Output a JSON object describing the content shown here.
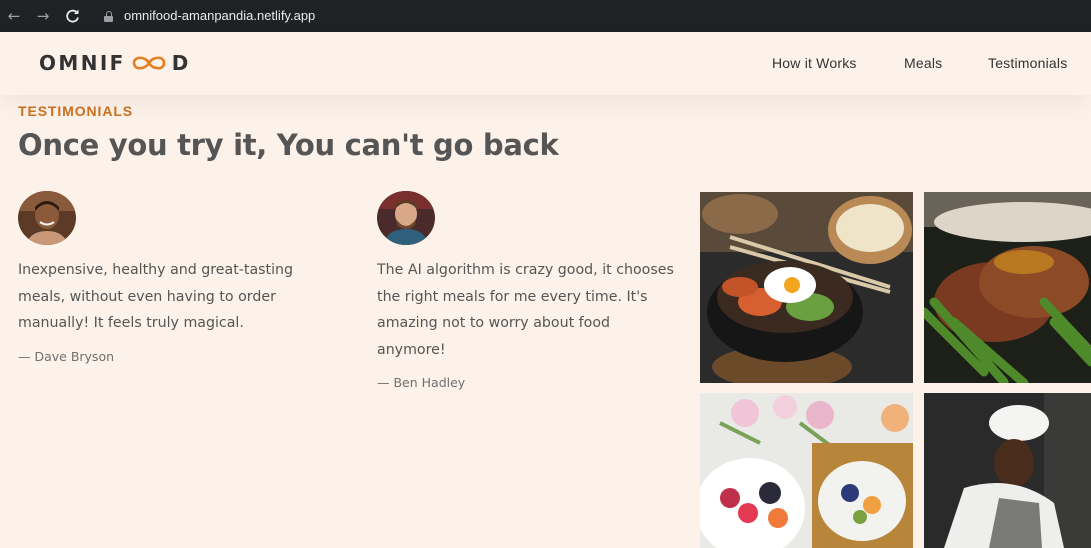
{
  "browser": {
    "url": "omnifood-amanpandia.netlify.app",
    "back_icon": "←",
    "forward_icon": "→",
    "reload_icon": "C"
  },
  "header": {
    "logo_left": "OMNIF",
    "logo_right": "D",
    "nav": [
      {
        "label": "How it Works"
      },
      {
        "label": "Meals"
      },
      {
        "label": "Testimonials"
      }
    ]
  },
  "section": {
    "eyebrow": "TESTIMONIALS",
    "heading": "Once you try it, You can't go back"
  },
  "testimonials": [
    {
      "quote": "Inexpensive, healthy and great-tasting meals, without even having to order manually! It feels truly magical.",
      "author": "— Dave Bryson"
    },
    {
      "quote": "The AI algorithm is crazy good, it chooses the right meals for me every time. It's amazing not to worry about food anymore!",
      "author": "— Ben Hadley"
    }
  ],
  "colors": {
    "background": "#fdf2e9",
    "accent": "#e67e22",
    "eyebrow": "#cf711f",
    "text": "#555555"
  }
}
